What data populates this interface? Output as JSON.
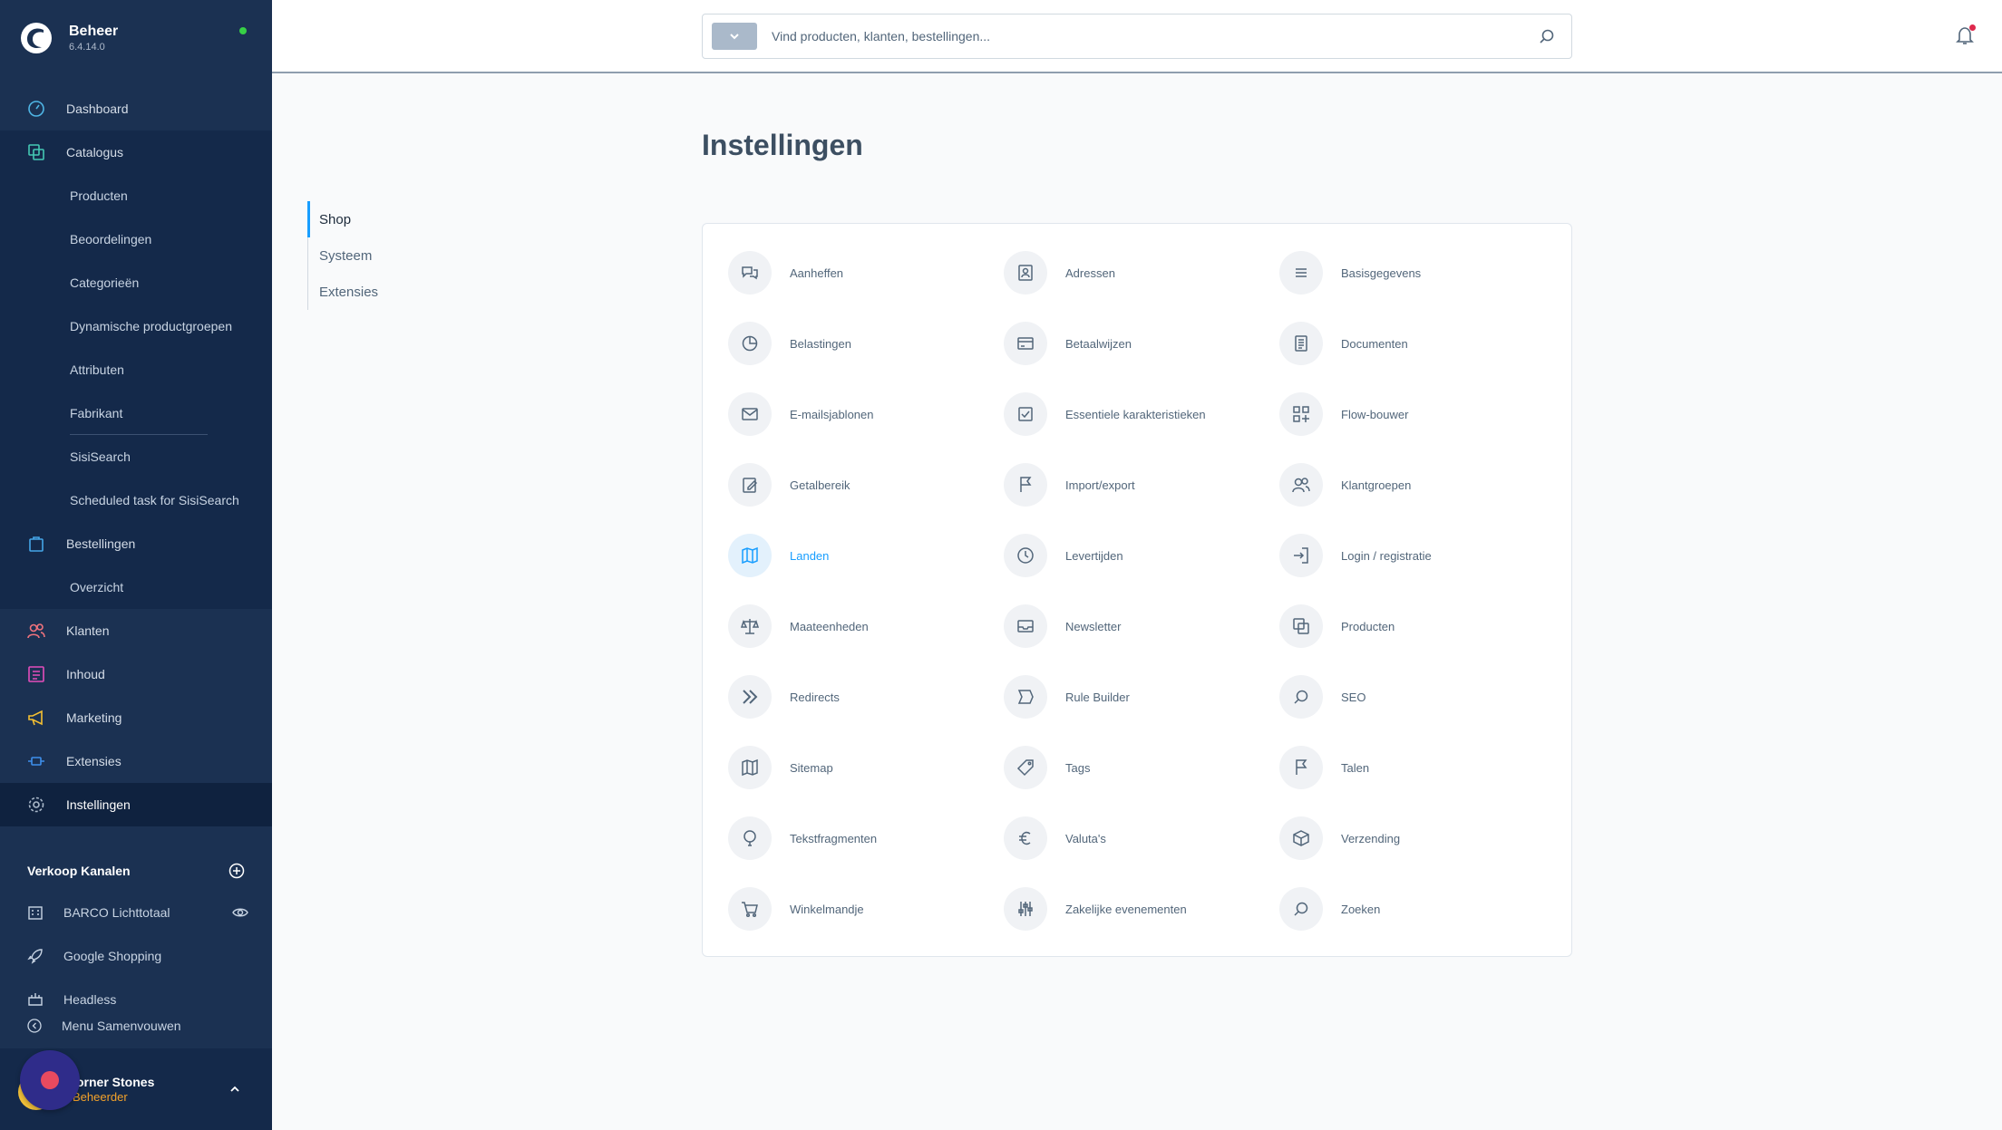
{
  "app": {
    "title": "Beheer",
    "version": "6.4.14.0"
  },
  "colors": {
    "sidebar": "#1b3152",
    "accent": "#189eff",
    "status_online": "#37d046"
  },
  "search": {
    "placeholder": "Vind producten, klanten, bestellingen..."
  },
  "nav": {
    "dashboard": "Dashboard",
    "catalogus": "Catalogus",
    "catalogus_items": [
      "Producten",
      "Beoordelingen",
      "Categorieën",
      "Dynamische productgroepen",
      "Attributen",
      "Fabrikant",
      "SisiSearch",
      "Scheduled task for SisiSearch"
    ],
    "bestellingen": "Bestellingen",
    "bestellingen_items": [
      "Overzicht"
    ],
    "klanten": "Klanten",
    "inhoud": "Inhoud",
    "marketing": "Marketing",
    "extensies": "Extensies",
    "instellingen": "Instellingen"
  },
  "sales_channels": {
    "title": "Verkoop Kanalen",
    "items": [
      "BARCO Lichttotaal",
      "Google Shopping",
      "Headless"
    ]
  },
  "collapse_label": "Menu Samenvouwen",
  "user": {
    "name": "Corner Stones",
    "name_visible": "orner Stones",
    "role": "Beheerder"
  },
  "page": {
    "title": "Instellingen",
    "tabs": [
      "Shop",
      "Systeem",
      "Extensies"
    ],
    "active_tab": "Shop"
  },
  "settings": [
    {
      "label": "Aanheffen",
      "icon": "chat-icon"
    },
    {
      "label": "Adressen",
      "icon": "address-book-icon"
    },
    {
      "label": "Basisgegevens",
      "icon": "list-icon"
    },
    {
      "label": "Belastingen",
      "icon": "pie-chart-icon"
    },
    {
      "label": "Betaalwijzen",
      "icon": "credit-card-icon"
    },
    {
      "label": "Documenten",
      "icon": "document-icon"
    },
    {
      "label": "E-mailsjablonen",
      "icon": "envelope-icon"
    },
    {
      "label": "Essentiele karakteristieken",
      "icon": "checkbox-icon"
    },
    {
      "label": "Flow-bouwer",
      "icon": "flow-icon"
    },
    {
      "label": "Getalbereik",
      "icon": "edit-icon"
    },
    {
      "label": "Import/export",
      "icon": "flag-icon"
    },
    {
      "label": "Klantgroepen",
      "icon": "users-icon"
    },
    {
      "label": "Landen",
      "icon": "map-icon",
      "active": true
    },
    {
      "label": "Levertijden",
      "icon": "clock-icon"
    },
    {
      "label": "Login / registratie",
      "icon": "sign-in-icon"
    },
    {
      "label": "Maateenheden",
      "icon": "scale-icon"
    },
    {
      "label": "Newsletter",
      "icon": "inbox-icon"
    },
    {
      "label": "Producten",
      "icon": "products-icon"
    },
    {
      "label": "Redirects",
      "icon": "double-chevron-icon"
    },
    {
      "label": "Rule Builder",
      "icon": "rule-icon"
    },
    {
      "label": "SEO",
      "icon": "search-icon"
    },
    {
      "label": "Sitemap",
      "icon": "map-icon"
    },
    {
      "label": "Tags",
      "icon": "tag-icon"
    },
    {
      "label": "Talen",
      "icon": "flag-icon"
    },
    {
      "label": "Tekstfragmenten",
      "icon": "balloon-icon"
    },
    {
      "label": "Valuta's",
      "icon": "euro-icon"
    },
    {
      "label": "Verzending",
      "icon": "box-icon"
    },
    {
      "label": "Winkelmandje",
      "icon": "cart-icon"
    },
    {
      "label": "Zakelijke evenementen",
      "icon": "sliders-icon"
    },
    {
      "label": "Zoeken",
      "icon": "search-icon"
    }
  ]
}
